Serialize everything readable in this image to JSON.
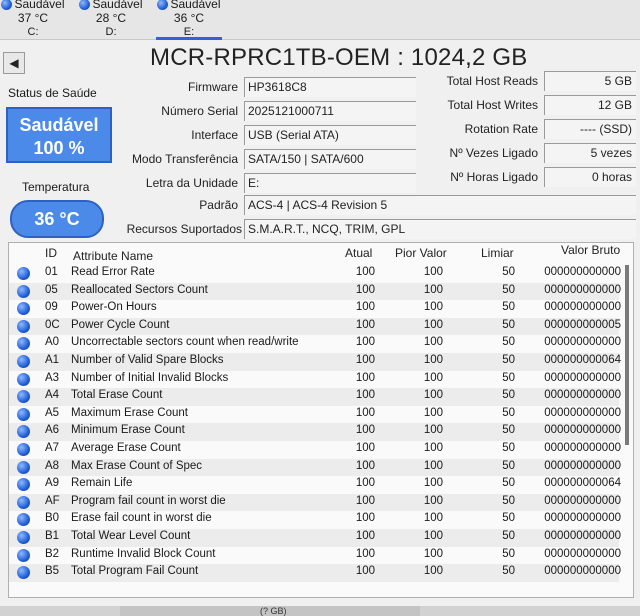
{
  "drives": [
    {
      "status": "Saudável",
      "temp": "37 °C",
      "letter": "C:",
      "selected": false
    },
    {
      "status": "Saudável",
      "temp": "28 °C",
      "letter": "D:",
      "selected": false
    },
    {
      "status": "Saudável",
      "temp": "36 °C",
      "letter": "E:",
      "selected": true
    }
  ],
  "title": "MCR-RPRC1TB-OEM : 1024,2 GB",
  "health": {
    "label": "Status de Saúde",
    "status": "Saudável",
    "percent": "100 %"
  },
  "temperature": {
    "label": "Temperatura",
    "value": "36 °C"
  },
  "info": {
    "firmware": {
      "label": "Firmware",
      "value": "HP3618C8"
    },
    "serial": {
      "label": "Número Serial",
      "value": "2025121000711"
    },
    "interface": {
      "label": "Interface",
      "value": "USB (Serial ATA)"
    },
    "transfer": {
      "label": "Modo Transferência",
      "value": "SATA/150 | SATA/600"
    },
    "drive_letter": {
      "label": "Letra da Unidade",
      "value": "E:"
    },
    "standard": {
      "label": "Padrão",
      "value": "ACS-4 | ACS-4 Revision 5"
    },
    "features": {
      "label": "Recursos Suportados",
      "value": "S.M.A.R.T., NCQ, TRIM, GPL"
    }
  },
  "stats": {
    "host_reads": {
      "label": "Total Host Reads",
      "value": "5 GB"
    },
    "host_writes": {
      "label": "Total Host Writes",
      "value": "12 GB"
    },
    "rotation": {
      "label": "Rotation Rate",
      "value": "---- (SSD)"
    },
    "power_count": {
      "label": "Nº Vezes Ligado",
      "value": "5 vezes"
    },
    "power_hours": {
      "label": "Nº Horas Ligado",
      "value": "0 horas"
    }
  },
  "table": {
    "headers": {
      "id": "ID",
      "name": "Attribute Name",
      "atual": "Atual",
      "pior": "Pior Valor",
      "limiar": "Limiar",
      "raw": "Valor Bruto"
    },
    "rows": [
      {
        "id": "01",
        "name": "Read Error Rate",
        "atual": "100",
        "pior": "100",
        "limiar": "50",
        "raw": "000000000000"
      },
      {
        "id": "05",
        "name": "Reallocated Sectors Count",
        "atual": "100",
        "pior": "100",
        "limiar": "50",
        "raw": "000000000000"
      },
      {
        "id": "09",
        "name": "Power-On Hours",
        "atual": "100",
        "pior": "100",
        "limiar": "50",
        "raw": "000000000000"
      },
      {
        "id": "0C",
        "name": "Power Cycle Count",
        "atual": "100",
        "pior": "100",
        "limiar": "50",
        "raw": "000000000005"
      },
      {
        "id": "A0",
        "name": "Uncorrectable sectors count when read/write",
        "atual": "100",
        "pior": "100",
        "limiar": "50",
        "raw": "000000000000"
      },
      {
        "id": "A1",
        "name": "Number of Valid Spare Blocks",
        "atual": "100",
        "pior": "100",
        "limiar": "50",
        "raw": "000000000064"
      },
      {
        "id": "A3",
        "name": "Number of Initial Invalid Blocks",
        "atual": "100",
        "pior": "100",
        "limiar": "50",
        "raw": "000000000000"
      },
      {
        "id": "A4",
        "name": "Total Erase Count",
        "atual": "100",
        "pior": "100",
        "limiar": "50",
        "raw": "000000000000"
      },
      {
        "id": "A5",
        "name": "Maximum Erase Count",
        "atual": "100",
        "pior": "100",
        "limiar": "50",
        "raw": "000000000000"
      },
      {
        "id": "A6",
        "name": "Minimum Erase Count",
        "atual": "100",
        "pior": "100",
        "limiar": "50",
        "raw": "000000000000"
      },
      {
        "id": "A7",
        "name": "Average Erase Count",
        "atual": "100",
        "pior": "100",
        "limiar": "50",
        "raw": "000000000000"
      },
      {
        "id": "A8",
        "name": "Max Erase Count of Spec",
        "atual": "100",
        "pior": "100",
        "limiar": "50",
        "raw": "000000000000"
      },
      {
        "id": "A9",
        "name": "Remain Life",
        "atual": "100",
        "pior": "100",
        "limiar": "50",
        "raw": "000000000064"
      },
      {
        "id": "AF",
        "name": "Program fail count in worst die",
        "atual": "100",
        "pior": "100",
        "limiar": "50",
        "raw": "000000000000"
      },
      {
        "id": "B0",
        "name": "Erase fail count in worst die",
        "atual": "100",
        "pior": "100",
        "limiar": "50",
        "raw": "000000000000"
      },
      {
        "id": "B1",
        "name": "Total Wear Level Count",
        "atual": "100",
        "pior": "100",
        "limiar": "50",
        "raw": "000000000000"
      },
      {
        "id": "B2",
        "name": "Runtime Invalid Block Count",
        "atual": "100",
        "pior": "100",
        "limiar": "50",
        "raw": "000000000000"
      },
      {
        "id": "B5",
        "name": "Total Program Fail Count",
        "atual": "100",
        "pior": "100",
        "limiar": "50",
        "raw": "000000000000"
      }
    ]
  },
  "bottom_hint": "(? GB)",
  "colors": {
    "accent": "#4b8ae8",
    "accent_border": "#2c62c4",
    "status_dot": "#1f5fd6"
  }
}
